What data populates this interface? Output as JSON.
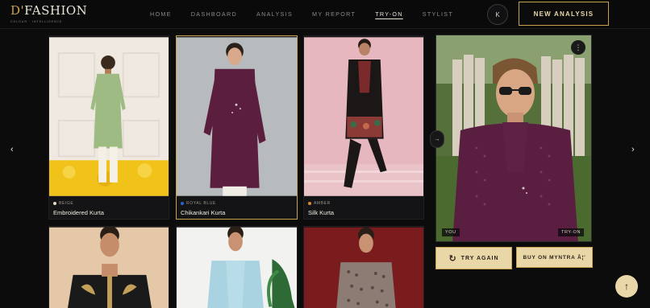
{
  "brand": {
    "name_prefix": "D'",
    "name_main": "FASHION",
    "tagline": "COLOUR · INTELLIGENCE"
  },
  "nav": [
    {
      "label": "HOME"
    },
    {
      "label": "DASHBOARD"
    },
    {
      "label": "ANALYSIS"
    },
    {
      "label": "MY REPORT"
    },
    {
      "label": "TRY-ON",
      "active": true
    },
    {
      "label": "STYLIST"
    }
  ],
  "user": {
    "initial": "K"
  },
  "actions": {
    "new_analysis": "NEW ANALYSIS"
  },
  "carousel": {
    "prev_icon": "chevron-left-icon",
    "next_icon": "chevron-right-icon",
    "prev_glyph": "‹",
    "next_glyph": "›"
  },
  "products": [
    {
      "color_name": "BEIGE",
      "color_hex": "#e8dcc0",
      "title": "Embroidered Kurta"
    },
    {
      "color_name": "ROYAL BLUE",
      "color_hex": "#2f5fd1",
      "title": "Chikankari Kurta",
      "selected": true
    },
    {
      "color_name": "AMBER",
      "color_hex": "#e08a2a",
      "title": "Silk Kurta"
    },
    {
      "color_name": "",
      "title": ""
    },
    {
      "color_name": "",
      "title": ""
    },
    {
      "color_name": "",
      "title": ""
    }
  ],
  "preview": {
    "menu_glyph": "⋮",
    "compare_glyph": "→",
    "label_left": "YOU",
    "label_right": "TRY-ON",
    "try_again": "TRY AGAIN",
    "try_again_glyph": "↻",
    "buy": "BUY ON MYNTRA Â¦'"
  },
  "scroll_top_glyph": "↑",
  "colors": {
    "accent": "#c9a24f",
    "button_bg": "#e9d7a8",
    "background": "#0c0c0d"
  }
}
